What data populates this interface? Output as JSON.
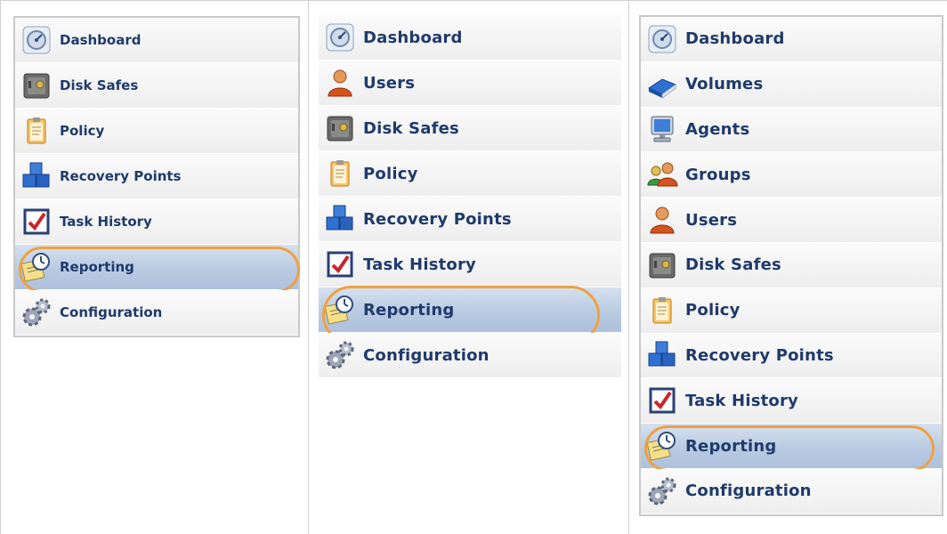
{
  "panels": [
    {
      "items": [
        {
          "label": "Dashboard",
          "icon": "dashboard-icon"
        },
        {
          "label": "Disk Safes",
          "icon": "disk-safe-icon"
        },
        {
          "label": "Policy",
          "icon": "policy-icon"
        },
        {
          "label": "Recovery Points",
          "icon": "recovery-points-icon"
        },
        {
          "label": "Task History",
          "icon": "task-history-icon"
        },
        {
          "label": "Reporting",
          "icon": "reporting-icon",
          "selected": true
        },
        {
          "label": "Configuration",
          "icon": "configuration-icon"
        }
      ]
    },
    {
      "items": [
        {
          "label": "Dashboard",
          "icon": "dashboard-icon"
        },
        {
          "label": "Users",
          "icon": "user-icon"
        },
        {
          "label": "Disk Safes",
          "icon": "disk-safe-icon"
        },
        {
          "label": "Policy",
          "icon": "policy-icon"
        },
        {
          "label": "Recovery Points",
          "icon": "recovery-points-icon"
        },
        {
          "label": "Task History",
          "icon": "task-history-icon"
        },
        {
          "label": "Reporting",
          "icon": "reporting-icon",
          "selected": true
        },
        {
          "label": "Configuration",
          "icon": "configuration-icon"
        }
      ]
    },
    {
      "items": [
        {
          "label": "Dashboard",
          "icon": "dashboard-icon"
        },
        {
          "label": "Volumes",
          "icon": "volumes-icon"
        },
        {
          "label": "Agents",
          "icon": "agents-icon"
        },
        {
          "label": "Groups",
          "icon": "groups-icon"
        },
        {
          "label": "Users",
          "icon": "user-icon"
        },
        {
          "label": "Disk Safes",
          "icon": "disk-safe-icon"
        },
        {
          "label": "Policy",
          "icon": "policy-icon"
        },
        {
          "label": "Recovery Points",
          "icon": "recovery-points-icon"
        },
        {
          "label": "Task History",
          "icon": "task-history-icon"
        },
        {
          "label": "Reporting",
          "icon": "reporting-icon",
          "selected": true
        },
        {
          "label": "Configuration",
          "icon": "configuration-icon"
        }
      ]
    }
  ],
  "colors": {
    "label": "#1f3a6b",
    "selected_bg": "#b9cbe2",
    "highlight_ring": "#f0a040"
  }
}
